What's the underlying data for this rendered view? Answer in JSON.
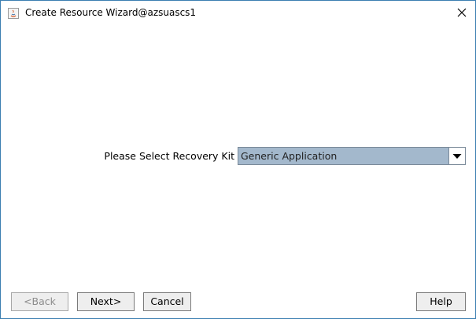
{
  "window": {
    "title": "Create Resource Wizard@azsuascs1"
  },
  "form": {
    "kit_label": "Please Select Recovery Kit",
    "kit_selected": "Generic Application"
  },
  "buttons": {
    "back": "<Back",
    "next": "Next>",
    "cancel": "Cancel",
    "help": "Help"
  },
  "icons": {
    "app": "java-app-icon",
    "close": "close-icon",
    "dropdown": "triangle-down-icon"
  }
}
